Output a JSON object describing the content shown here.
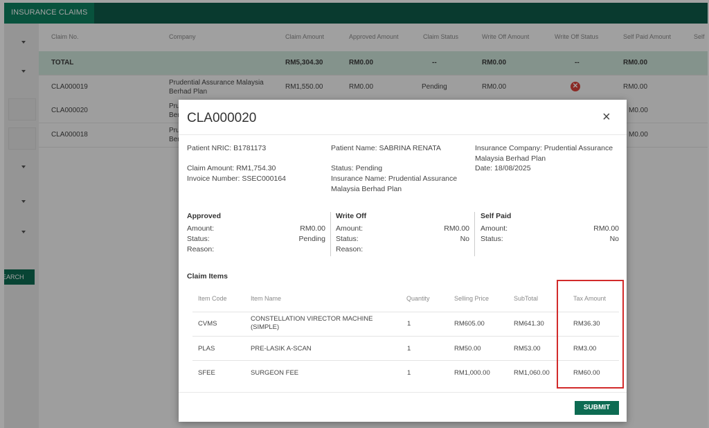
{
  "app": {
    "tab_label": "INSURANCE CLAIMS"
  },
  "sidebar": {
    "search_label": "EARCH"
  },
  "table": {
    "headers": [
      "Claim No.",
      "Company",
      "Claim Amount",
      "Approved Amount",
      "Claim Status",
      "Write Off Amount",
      "Write Off Status",
      "Self Paid Amount",
      "Self"
    ],
    "total": {
      "label": "TOTAL",
      "claim_amount": "RM5,304.30",
      "approved_amount": "RM0.00",
      "claim_status": "--",
      "write_off_amount": "RM0.00",
      "write_off_status": "--",
      "self_paid_amount": "RM0.00"
    },
    "rows": [
      {
        "claim_no": "CLA000019",
        "company": "Prudential Assurance Malaysia Berhad Plan",
        "claim_amount": "RM1,550.00",
        "approved_amount": "RM0.00",
        "claim_status": "Pending",
        "write_off_amount": "RM0.00",
        "write_off_status_icon": "x-circle-icon",
        "self_paid_amount": "RM0.00"
      },
      {
        "claim_no": "CLA000020",
        "company": "Pru Ber",
        "self_paid_amount": "M0.00"
      },
      {
        "claim_no": "CLA000018",
        "company": "Pru Ber",
        "self_paid_amount": "M0.00"
      }
    ]
  },
  "modal": {
    "title": "CLA000020",
    "close_symbol": "×",
    "info": {
      "patient_nric": "Patient NRIC: B1781173",
      "claim_amount": "Claim Amount: RM1,754.30",
      "invoice_number": "Invoice Number: SSEC000164",
      "patient_name": "Patient Name: SABRINA RENATA",
      "status": "Status: Pending",
      "insurance_name_1": "Insurance Name: Prudential Assurance",
      "insurance_name_2": "Malaysia Berhad Plan",
      "insurance_company_1": "Insurance Company: Prudential Assurance",
      "insurance_company_2": "Malaysia Berhad Plan",
      "date": "Date: 18/08/2025"
    },
    "approved": {
      "title": "Approved",
      "amount_label": "Amount:",
      "amount_value": "RM0.00",
      "status_label": "Status:",
      "status_value": "Pending",
      "reason_label": "Reason:"
    },
    "write_off": {
      "title": "Write Off",
      "amount_label": "Amount:",
      "amount_value": "RM0.00",
      "status_label": "Status:",
      "status_value": "No",
      "reason_label": "Reason:"
    },
    "self_paid": {
      "title": "Self Paid",
      "amount_label": "Amount:",
      "amount_value": "RM0.00",
      "status_label": "Status:",
      "status_value": "No"
    },
    "claim_items": {
      "title": "Claim Items",
      "headers": [
        "Item Code",
        "Item Name",
        "Quantity",
        "Selling Price",
        "SubTotal",
        "Tax Amount"
      ],
      "rows": [
        {
          "code": "CVMS",
          "name": "CONSTELLATION VIRECTOR MACHINE (SIMPLE)",
          "qty": "1",
          "price": "RM605.00",
          "subtotal": "RM641.30",
          "tax": "RM36.30"
        },
        {
          "code": "PLAS",
          "name": "PRE-LASIK A-SCAN",
          "qty": "1",
          "price": "RM50.00",
          "subtotal": "RM53.00",
          "tax": "RM3.00"
        },
        {
          "code": "SFEE",
          "name": "SURGEON FEE",
          "qty": "1",
          "price": "RM1,000.00",
          "subtotal": "RM1,060.00",
          "tax": "RM60.00"
        }
      ]
    },
    "submit_label": "SUBMIT"
  },
  "colors": {
    "header_bar": "#0f5c4a",
    "tab_active": "#0d8060",
    "total_row": "#cfe6dc",
    "button": "#0d6b52",
    "highlight_box": "#d22a2a",
    "error_icon": "#d9433a"
  }
}
